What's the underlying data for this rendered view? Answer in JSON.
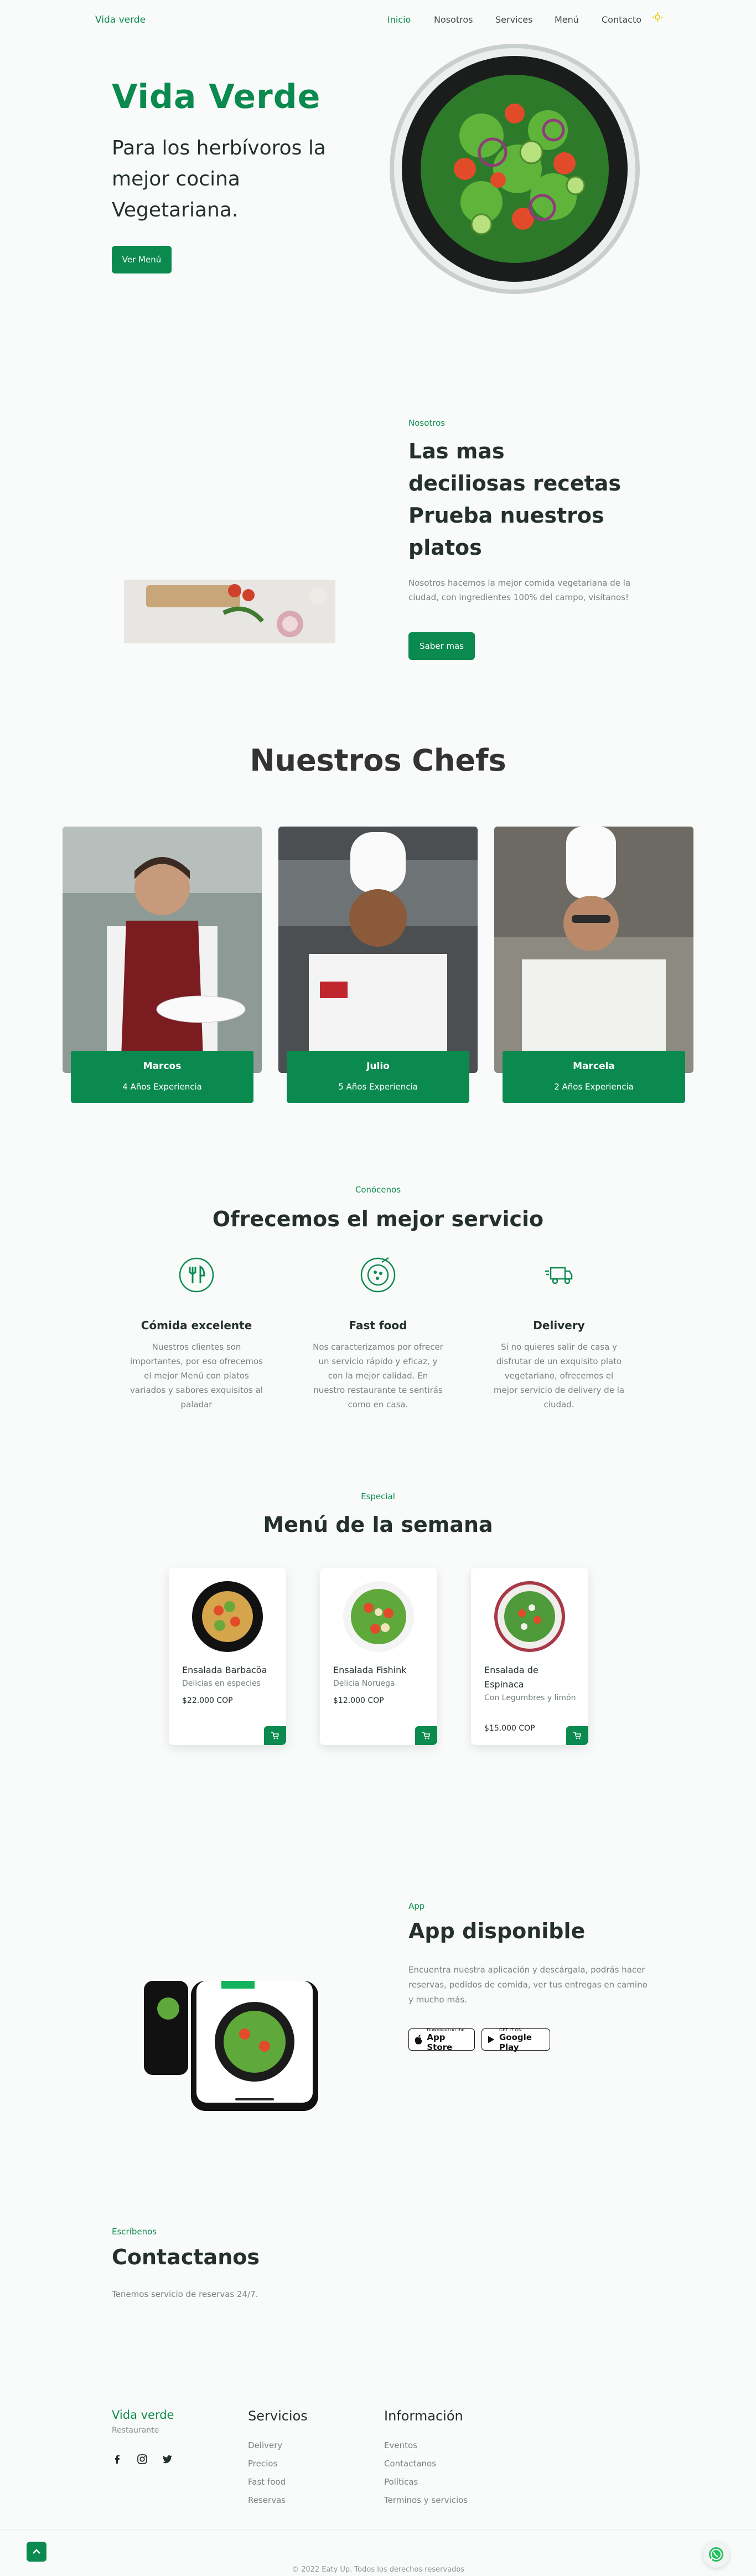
{
  "nav": {
    "logo": "Vida verde",
    "links": [
      "Inicio",
      "Nosotros",
      "Services",
      "Menú",
      "Contacto"
    ],
    "theme_icon": "sun-icon"
  },
  "hero": {
    "title": "Vida Verde",
    "subtitle": "Para los herbívoros la mejor cocina Vegetariana.",
    "button": "Ver Menú"
  },
  "about": {
    "tag": "Nosotros",
    "title_line1": "Las mas deciliosas recetas",
    "title_line2": "Prueba nuestros platos",
    "text": "Nosotros hacemos la mejor comida vegetariana de la ciudad, con ingredientes 100% del campo, visítanos!",
    "button": "Saber mas"
  },
  "chefs": {
    "title": "Nuestros Chefs",
    "items": [
      {
        "name": "Marcos",
        "experience": "4 Años Experiencia"
      },
      {
        "name": "Julio",
        "experience": "5 Años Experiencia"
      },
      {
        "name": "Marcela",
        "experience": "2 Años Experiencia"
      }
    ]
  },
  "services": {
    "tag": "Conócenos",
    "title": "Ofrecemos el mejor servicio",
    "items": [
      {
        "icon": "utensils-icon",
        "title": "Cómida excelente",
        "text": "Nuestros clientes son importantes, por eso ofrecemos el mejor Menú con platos variados y sabores exquisitos al paladar"
      },
      {
        "icon": "pizza-icon",
        "title": "Fast food",
        "text": "Nos caracterizamos por ofrecer un servicio rápido y eficaz, y con la mejor calidad. En nuestro restaurante te sentirás como en casa."
      },
      {
        "icon": "delivery-truck-icon",
        "title": "Delivery",
        "text": "Si no quieres salir de casa y disfrutar de un exquisito plato vegetariano, ofrecemos el mejor servicio de delivery de la ciudad."
      }
    ]
  },
  "menu": {
    "tag": "Especial",
    "title": "Menú de la semana",
    "items": [
      {
        "name": "Ensalada Barbacöa",
        "description": "Delicias en especies",
        "price": "$22.000 COP"
      },
      {
        "name": "Ensalada Fishink",
        "description": "Delicia Noruega",
        "price": "$12.000 COP"
      },
      {
        "name": "Ensalada de Espinaca",
        "description": "Con Legumbres y limón",
        "price": "$15.000 COP"
      }
    ]
  },
  "app": {
    "tag": "App",
    "title": "App disponible",
    "text": "Encuentra nuestra aplicación y descárgala, podrás hacer reservas, pedidos de comida, ver tus entregas en camino y mucho más.",
    "app_store_small": "Download on the",
    "app_store_big": "App Store",
    "play_small": "GET IT ON",
    "play_big": "Google Play"
  },
  "contact": {
    "tag": "Escríbenos",
    "title": "Contactanos",
    "text": "Tenemos servicio de reservas 24/7."
  },
  "footer": {
    "logo": "Vida verde",
    "subtitle": "Restaurante",
    "social_icons": [
      "facebook-icon",
      "instagram-icon",
      "twitter-icon"
    ],
    "services_title": "Servicios",
    "services_links": [
      "Delivery",
      "Precios",
      "Fast food",
      "Reservas"
    ],
    "info_title": "Información",
    "info_links": [
      "Eventos",
      "Contactanos",
      "Políticas",
      "Terminos y servicios"
    ],
    "copyright": "© 2022 Eaty Up. Todos los derechos reservados"
  },
  "colors": {
    "accent": "#0b8a4f",
    "background": "#f9fbfa",
    "text": "#24302b"
  }
}
